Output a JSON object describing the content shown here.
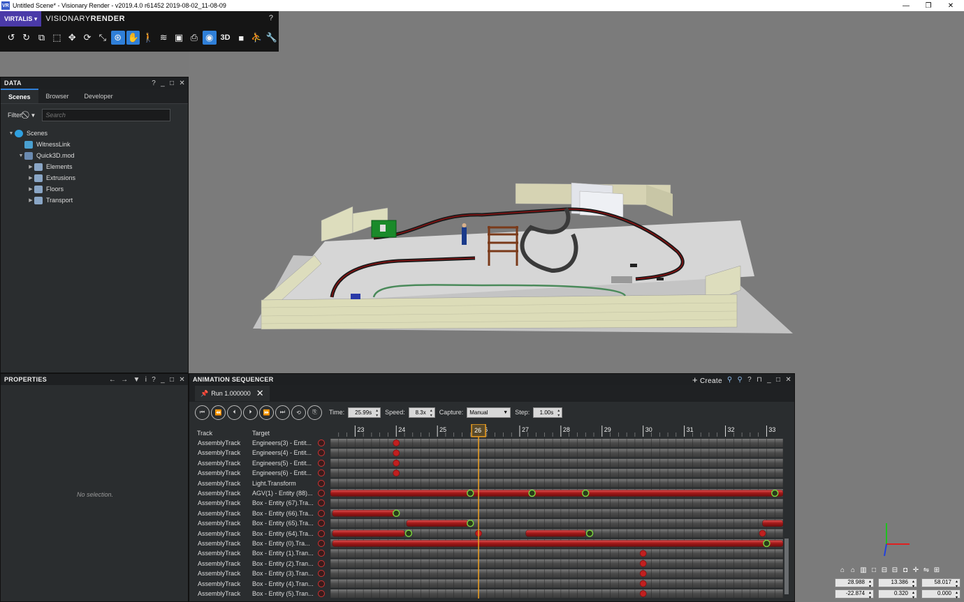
{
  "window": {
    "title": "Untitled Scene* - Visionary Render - v2019.4.0 r61452 2019-08-02_11-08-09",
    "app_icon": "VR",
    "controls": [
      "—",
      "❐",
      "✕"
    ]
  },
  "toolbar": {
    "brand": "VIRTALIS ▾",
    "product_light": "VISIONARY",
    "product_bold": "RENDER",
    "help": "?",
    "tools": [
      {
        "icon": "undo-icon",
        "glyph": "↺",
        "active": false
      },
      {
        "icon": "redo-icon",
        "glyph": "↻",
        "active": false
      },
      {
        "icon": "copy-icon",
        "glyph": "⧉",
        "active": false
      },
      {
        "icon": "select-box-icon",
        "glyph": "⬚",
        "active": false
      },
      {
        "icon": "move-icon",
        "glyph": "✥",
        "active": false
      },
      {
        "icon": "rotate-icon",
        "glyph": "⟳",
        "active": false
      },
      {
        "icon": "scale-icon",
        "glyph": "⤡",
        "active": false
      },
      {
        "icon": "orbit-icon",
        "glyph": "⊛",
        "active": true
      },
      {
        "icon": "pan-icon",
        "glyph": "✋",
        "active": true
      },
      {
        "icon": "walk-icon",
        "glyph": "🚶",
        "active": false
      },
      {
        "icon": "wireless-icon",
        "glyph": "≋",
        "active": false
      },
      {
        "icon": "fit-icon",
        "glyph": "▣",
        "active": false
      },
      {
        "icon": "camera-icon",
        "glyph": "⎙",
        "active": false
      },
      {
        "icon": "light-icon",
        "glyph": "◉",
        "active": true
      },
      {
        "icon": "3d-icon",
        "glyph": "3D",
        "active": false
      },
      {
        "icon": "square-icon",
        "glyph": "■",
        "active": false
      },
      {
        "icon": "character-icon",
        "glyph": "⛹",
        "active": false
      },
      {
        "icon": "wrench-icon",
        "glyph": "🔧",
        "active": false
      }
    ]
  },
  "data_panel": {
    "title": "DATA",
    "controls": [
      "?",
      "_",
      "□",
      "✕"
    ],
    "tabs": [
      {
        "label": "Scenes",
        "active": true
      },
      {
        "label": "Browser",
        "active": false
      },
      {
        "label": "Developer",
        "active": false
      }
    ],
    "filter_label": "Filter:",
    "search_placeholder": "Search",
    "tree": [
      {
        "label": "Scenes",
        "depth": 0,
        "expanded": true,
        "icon": "globe-icon",
        "color": "#2fa0e0"
      },
      {
        "label": "WitnessLink",
        "depth": 1,
        "expanded": null,
        "icon": "link-icon",
        "color": "#4aa0d0"
      },
      {
        "label": "Quick3D.mod",
        "depth": 1,
        "expanded": true,
        "icon": "model-icon",
        "color": "#6a8ab0"
      },
      {
        "label": "Elements",
        "depth": 2,
        "expanded": false,
        "icon": "assembly-icon",
        "color": "#8aa6c6"
      },
      {
        "label": "Extrusions",
        "depth": 2,
        "expanded": false,
        "icon": "assembly-icon",
        "color": "#8aa6c6"
      },
      {
        "label": "Floors",
        "depth": 2,
        "expanded": false,
        "icon": "assembly-icon",
        "color": "#8aa6c6"
      },
      {
        "label": "Transport",
        "depth": 2,
        "expanded": false,
        "icon": "assembly-icon",
        "color": "#8aa6c6"
      }
    ]
  },
  "properties_panel": {
    "title": "PROPERTIES",
    "controls": [
      "←",
      "→",
      "▼",
      "i",
      "?",
      "_",
      "□",
      "✕"
    ],
    "empty_text": "No selection."
  },
  "sequencer": {
    "title": "ANIMATION SEQUENCER",
    "create_label": "Create",
    "controls": [
      "+",
      "⚲",
      "⚲",
      "?",
      "⊓",
      "_",
      "□",
      "✕"
    ],
    "run_tab": "Run 1.000000",
    "time_label": "Time:",
    "time_value": "25.99s",
    "speed_label": "Speed:",
    "speed_value": "8.3x",
    "capture_label": "Capture:",
    "capture_value": "Manual",
    "step_label": "Step:",
    "step_value": "1.00s",
    "playback_buttons": [
      "⏮",
      "⏪",
      "⏴",
      "⏵",
      "⏩",
      "⏭",
      "⟲",
      "⎘"
    ],
    "track_header": "Track",
    "target_header": "Target",
    "ruler_start": 22.4,
    "ruler_end": 33.4,
    "ticks": [
      "23",
      "24",
      "25",
      "26",
      "27",
      "28",
      "29",
      "30",
      "31",
      "32",
      "33"
    ],
    "playhead": 26,
    "playhead_label": "26",
    "tracks": [
      {
        "track": "AssemblyTrack",
        "target": "Engineers(3) - Entit...",
        "keys": [
          24
        ],
        "bars": []
      },
      {
        "track": "AssemblyTrack",
        "target": "Engineers(4) - Entit...",
        "keys": [
          24
        ],
        "bars": []
      },
      {
        "track": "AssemblyTrack",
        "target": "Engineers(5) - Entit...",
        "keys": [
          24
        ],
        "bars": []
      },
      {
        "track": "AssemblyTrack",
        "target": "Engineers(6) - Entit...",
        "keys": [
          24
        ],
        "bars": []
      },
      {
        "track": "AssemblyTrack",
        "target": "Light.Transform",
        "keys": [],
        "bars": []
      },
      {
        "track": "AssemblyTrack",
        "target": "AGV(1) - Entity (88)...",
        "keys": [],
        "bars": [
          [
            22.4,
            33.4
          ]
        ],
        "ends": [
          25.8,
          27.3,
          28.6,
          33.2
        ]
      },
      {
        "track": "AssemblyTrack",
        "target": "Box - Entity (67).Tra...",
        "keys": [],
        "bars": [],
        "grey": true
      },
      {
        "track": "AssemblyTrack",
        "target": "Box - Entity (66).Tra...",
        "keys": [],
        "bars": [
          [
            22.45,
            24.0
          ]
        ],
        "ends": [
          24.0
        ]
      },
      {
        "track": "AssemblyTrack",
        "target": "Box - Entity (65).Tra...",
        "keys": [],
        "bars": [
          [
            24.25,
            25.75
          ],
          [
            32.9,
            33.4
          ]
        ],
        "ends": [
          25.8
        ]
      },
      {
        "track": "AssemblyTrack",
        "target": "Box - Entity (64).Tra...",
        "keys": [
          26.0,
          32.9
        ],
        "bars": [
          [
            22.45,
            24.2
          ],
          [
            27.15,
            28.6
          ]
        ],
        "ends": [
          24.3,
          28.7
        ]
      },
      {
        "track": "AssemblyTrack",
        "target": "Box - Entity (0).Tra...",
        "keys": [],
        "bars": [
          [
            22.45,
            33.4
          ]
        ],
        "ends": [
          33.0
        ]
      },
      {
        "track": "AssemblyTrack",
        "target": "Box - Entity (1).Tran...",
        "keys": [
          30.0
        ],
        "bars": []
      },
      {
        "track": "AssemblyTrack",
        "target": "Box - Entity (2).Tran...",
        "keys": [
          30.0
        ],
        "bars": []
      },
      {
        "track": "AssemblyTrack",
        "target": "Box - Entity (3).Tran...",
        "keys": [
          30.0
        ],
        "bars": []
      },
      {
        "track": "AssemblyTrack",
        "target": "Box - Entity (4).Tran...",
        "keys": [
          30.0
        ],
        "bars": []
      },
      {
        "track": "AssemblyTrack",
        "target": "Box - Entity (5).Tran...",
        "keys": [
          30.0
        ],
        "bars": []
      }
    ]
  },
  "viewport": {
    "view_icons": [
      "⌂",
      "⌂",
      "▥",
      "□",
      "⊟",
      "⊟",
      "◘",
      "✛",
      "⇋",
      "⊞"
    ],
    "coords_row1": [
      "28.988",
      "13.386",
      "58.017"
    ],
    "coords_row2": [
      "-22.874",
      "0.320",
      "0.000"
    ],
    "axis_colors": {
      "x": "#e02020",
      "y": "#20c020",
      "z": "#2040e0"
    }
  }
}
